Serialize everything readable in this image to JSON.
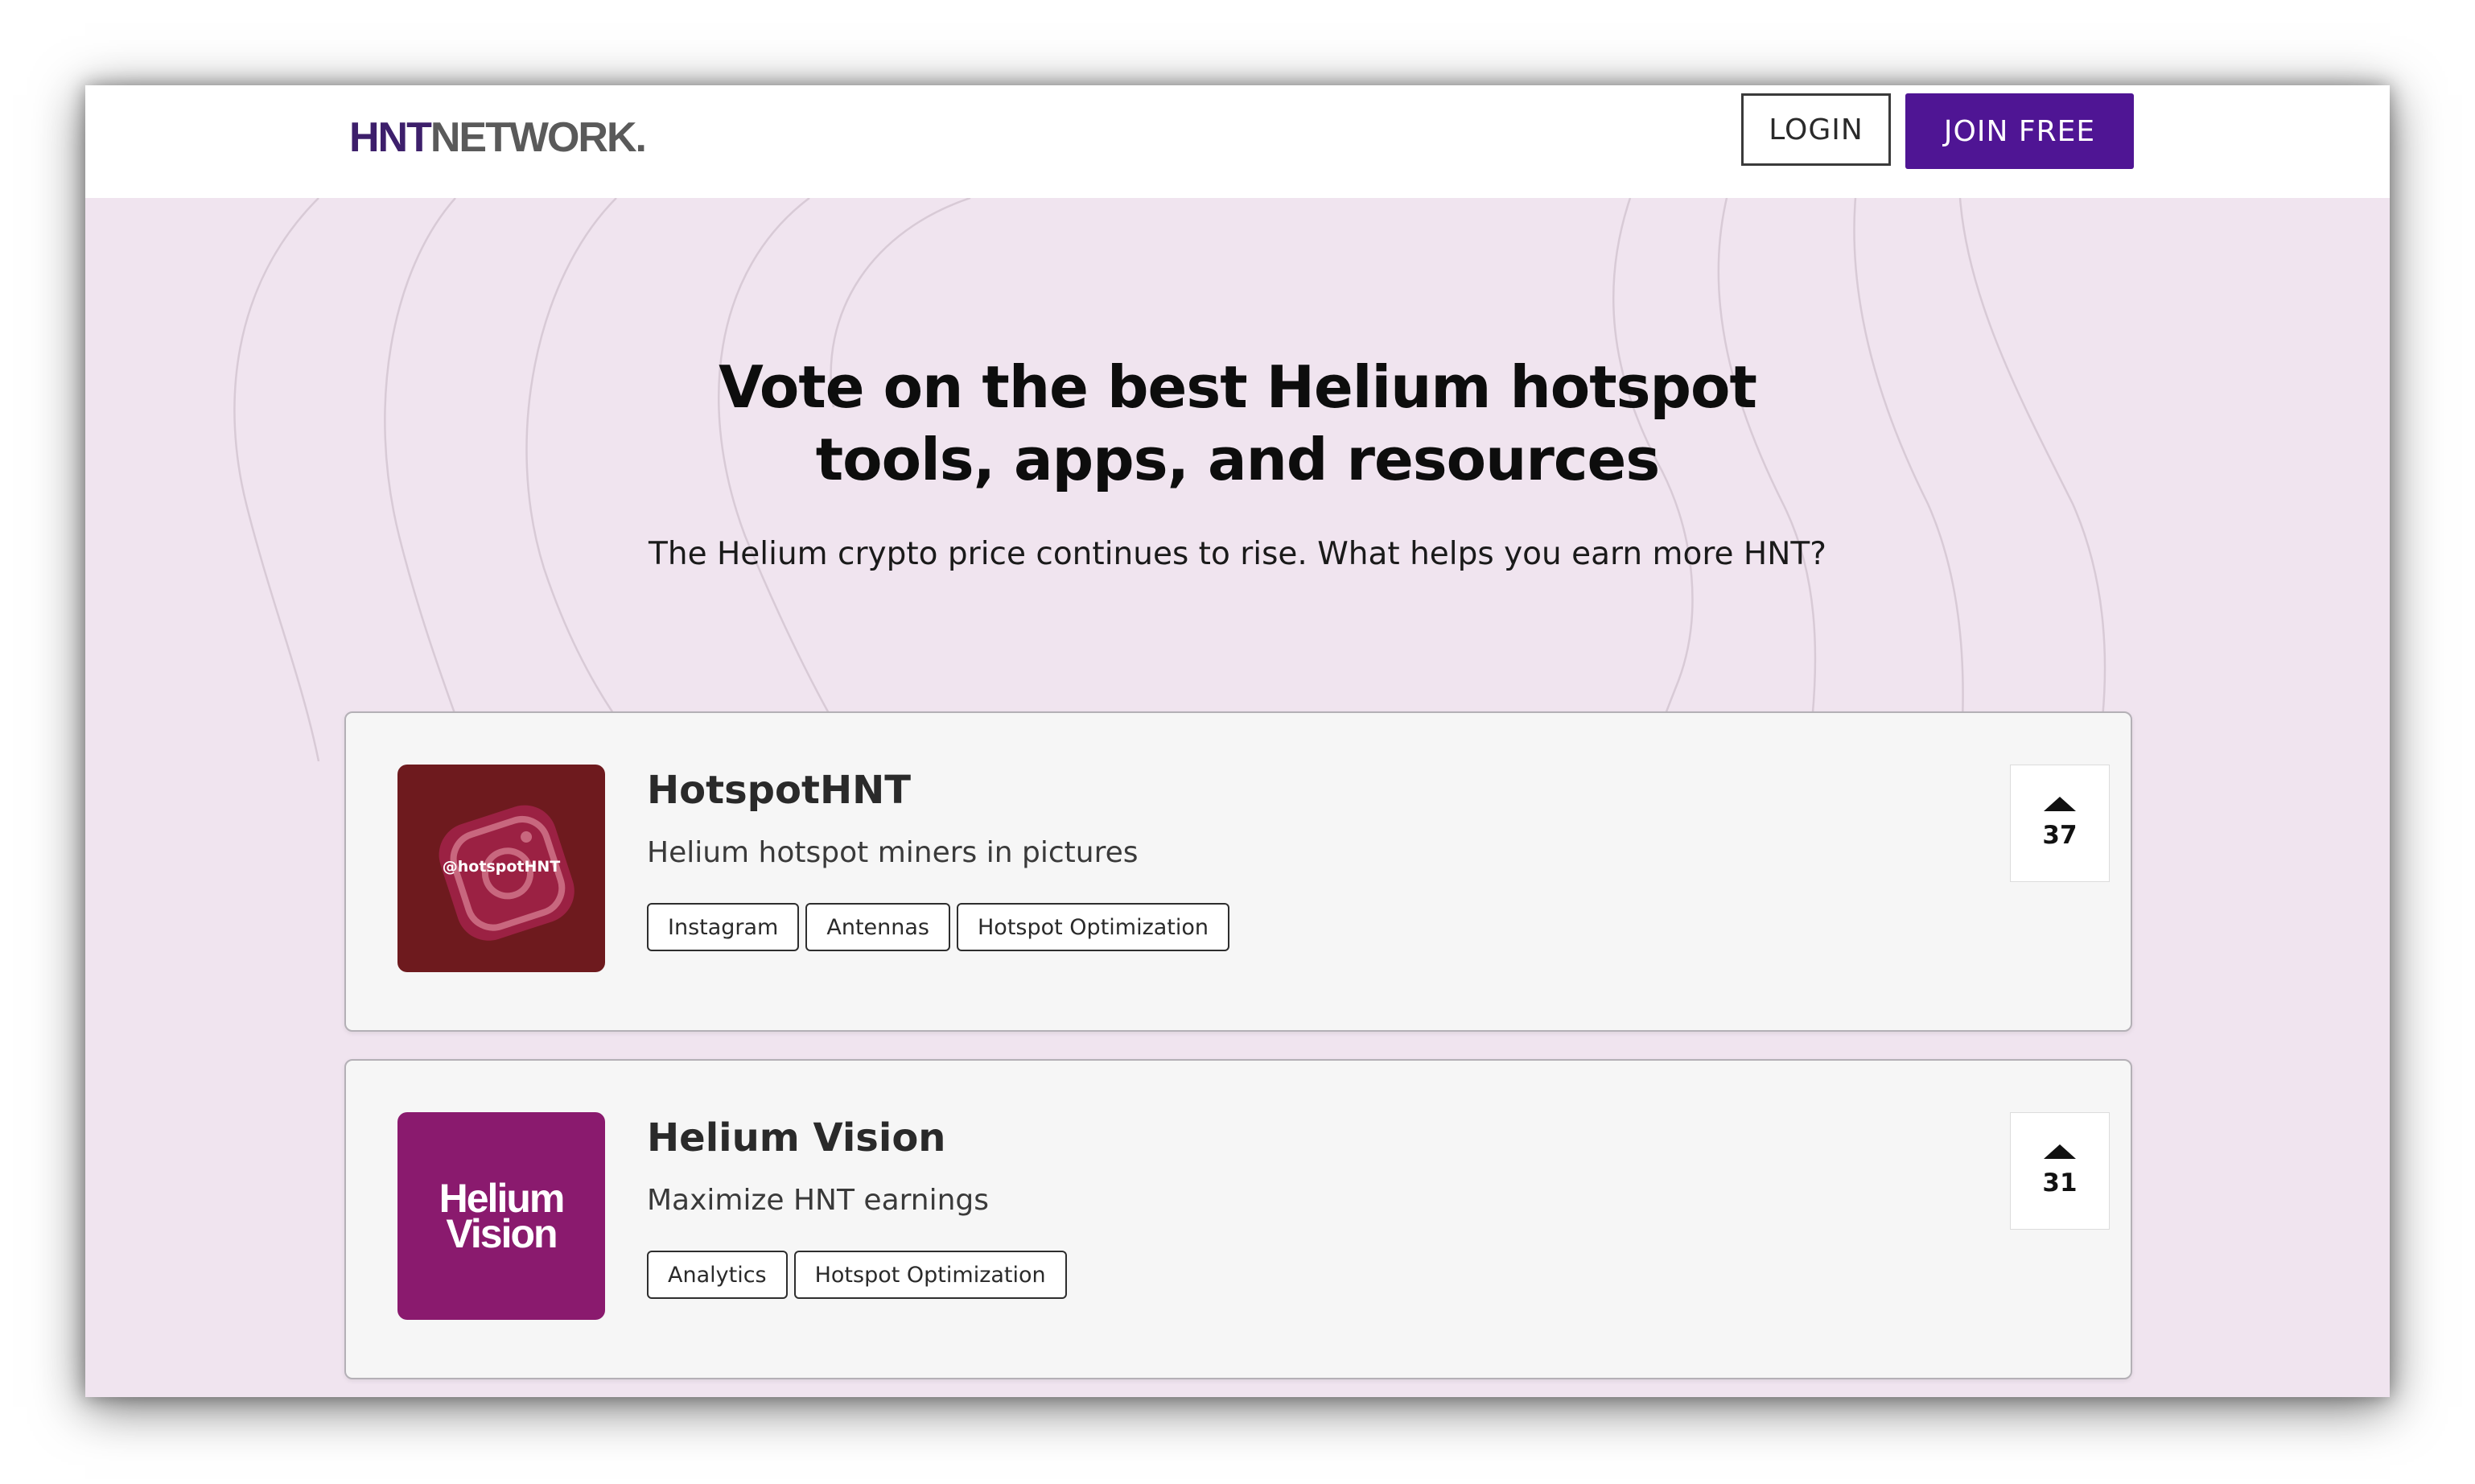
{
  "header": {
    "logo_part1": "HNT",
    "logo_part2": "NETWORK",
    "logo_part3": ".",
    "login_label": "LOGIN",
    "join_label": "JOIN FREE"
  },
  "hero": {
    "title": "Vote on the best Helium hotspot tools, apps, and resources",
    "subtitle": "The Helium crypto price continues to rise. What helps you earn more HNT?"
  },
  "listings": [
    {
      "title": "HotspotHNT",
      "description": "Helium hotspot miners in pictures",
      "thumb_text": "@hotspotHNT",
      "tags": [
        "Instagram",
        "Antennas",
        "Hotspot Optimization"
      ],
      "votes": "37"
    },
    {
      "title": "Helium Vision",
      "description": "Maximize HNT earnings",
      "thumb_text": "Helium\nVision",
      "tags": [
        "Analytics",
        "Hotspot Optimization"
      ],
      "votes": "31"
    }
  ],
  "colors": {
    "brand_purple": "#4f1594",
    "page_background": "#f0e4ef",
    "hotspothnt_thumb": "#6e1a1e",
    "helium_vision_thumb": "#8a1a6e"
  },
  "icons": {
    "upvote": "triangle-up-icon"
  }
}
